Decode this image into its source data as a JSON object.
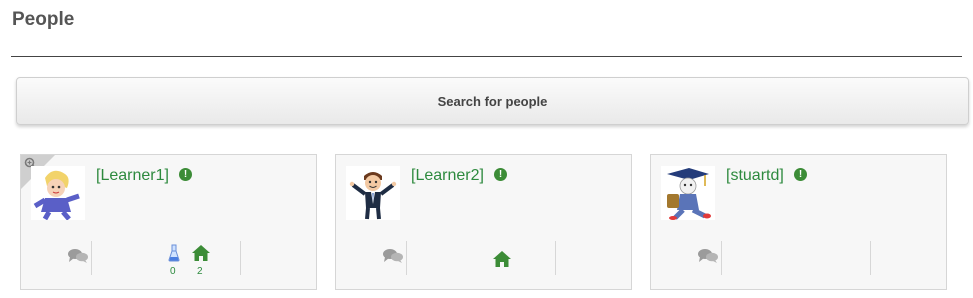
{
  "page": {
    "title": "People"
  },
  "search": {
    "label": "Search for people"
  },
  "people": [
    {
      "name": "[Learner1]",
      "alert": "!",
      "avatar": "blonde-girl-cartoon",
      "badges": {
        "learning": "0",
        "home": "2"
      }
    },
    {
      "name": "[Learner2]",
      "alert": "!",
      "avatar": "businessman-cartoon"
    },
    {
      "name": "[stuartd]",
      "alert": "!",
      "avatar": "graduate-cat-cartoon"
    }
  ],
  "colors": {
    "link_green": "#2d8a3e",
    "icon_gray": "#9b9b9b",
    "home_green": "#3c8c37"
  }
}
